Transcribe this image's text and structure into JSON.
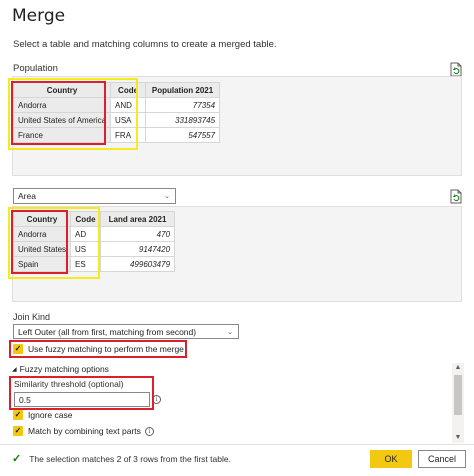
{
  "dialog": {
    "title": "Merge",
    "subtitle": "Select a table and matching columns to create a merged table."
  },
  "top_table": {
    "label": "Population",
    "columns": [
      "Country",
      "Code",
      "Population 2021"
    ],
    "rows": [
      [
        "Andorra",
        "AND",
        "77354"
      ],
      [
        "United States of America",
        "USA",
        "331893745"
      ],
      [
        "France",
        "FRA",
        "547557"
      ]
    ]
  },
  "bottom_table": {
    "selected": "Area",
    "columns": [
      "Country",
      "Code",
      "Land area 2021"
    ],
    "rows": [
      [
        "Andorra",
        "AD",
        "470"
      ],
      [
        "United States",
        "US",
        "9147420"
      ],
      [
        "Spain",
        "ES",
        "499603479"
      ]
    ]
  },
  "join": {
    "label": "Join Kind",
    "selected": "Left Outer (all from first, matching from second)",
    "fuzzy_label": "Use fuzzy matching to perform the merge",
    "fuzzy_checked": true
  },
  "fuzzy_options": {
    "header": "Fuzzy matching options",
    "threshold_label": "Similarity threshold (optional)",
    "threshold_value": "0.5",
    "ignore_case_label": "Ignore case",
    "combine_label": "Match by combining text parts"
  },
  "footer": {
    "status": "The selection matches 2 of 3 rows from the first table.",
    "ok_label": "OK",
    "cancel_label": "Cancel"
  },
  "colors": {
    "accent": "#f2c811",
    "highlight_red": "#d9202b",
    "highlight_yellow": "#f4ea1e",
    "success": "#107c10"
  }
}
